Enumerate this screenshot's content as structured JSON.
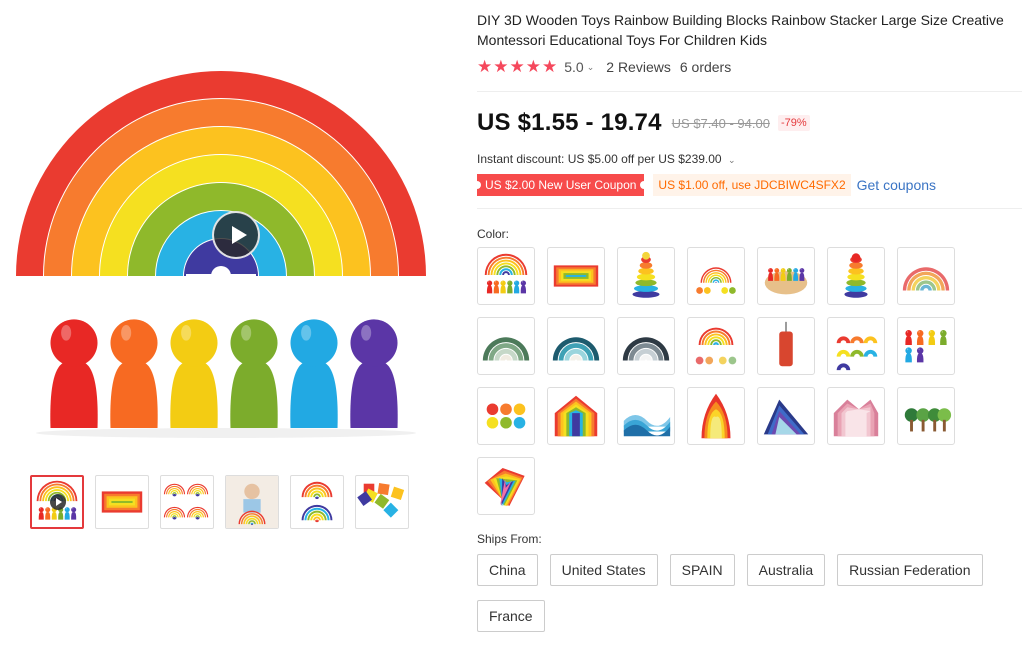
{
  "product": {
    "title": "DIY 3D Wooden Toys Rainbow Building Blocks Rainbow Stacker Large Size Creative Montessori Educational Toys For Children Kids",
    "rating": "5.0",
    "rating_stars": 5,
    "reviews": "2 Reviews",
    "orders": "6 orders"
  },
  "price": {
    "current": "US $1.55 - 19.74",
    "original": "US $7.40 - 94.00",
    "discount": "-79%",
    "instant_discount": "Instant discount: US $5.00 off per US $239.00"
  },
  "coupons": {
    "new_user": "US $2.00 New User Coupon",
    "code": "US $1.00 off, use JDCBIWC4SFX2",
    "get_link": "Get coupons"
  },
  "color": {
    "label": "Color:",
    "swatch_icons": [
      "rainbow-with-peg-dolls-icon",
      "flat-rainbow-stacker-icon",
      "ring-stacker-tower-icon",
      "rainbow-toy-set-icon",
      "peg-dolls-on-plate-icon",
      "stacking-rings-icon",
      "pastel-rainbow-icon",
      "green-arches-icon",
      "teal-arches-icon",
      "grey-arches-icon",
      "rainbow-accessories-icon",
      "lacing-toy-icon",
      "rainbow-pieces-set-icon",
      "people-figures-icon",
      "colored-balls-icon",
      "rainbow-house-icon",
      "wave-blocks-icon",
      "fire-stacker-icon",
      "mountain-stacker-icon",
      "pink-house-icon",
      "wooden-trees-icon",
      "heart-puzzle-icon"
    ]
  },
  "ships_from": {
    "label": "Ships From:",
    "options": [
      "China",
      "United States",
      "SPAIN",
      "Australia",
      "Russian Federation",
      "France"
    ]
  },
  "gallery": {
    "thumbnail_icons": [
      "video-thumbnail-icon",
      "flat-rainbow-thumbnail-icon",
      "rainbow-collage-thumbnail-icon",
      "child-playing-thumbnail-icon",
      "rainbow-stacks-thumbnail-icon",
      "block-structure-thumbnail-icon"
    ],
    "rainbow_colors": [
      "#ea3b30",
      "#f77b2e",
      "#fcc21f",
      "#f5e020",
      "#8fb92b",
      "#28b2e4",
      "#3f3aa0"
    ],
    "doll_colors": [
      "#e82825",
      "#f76a22",
      "#f3cc13",
      "#7cac2c",
      "#22a9e3",
      "#5b36a6"
    ]
  }
}
